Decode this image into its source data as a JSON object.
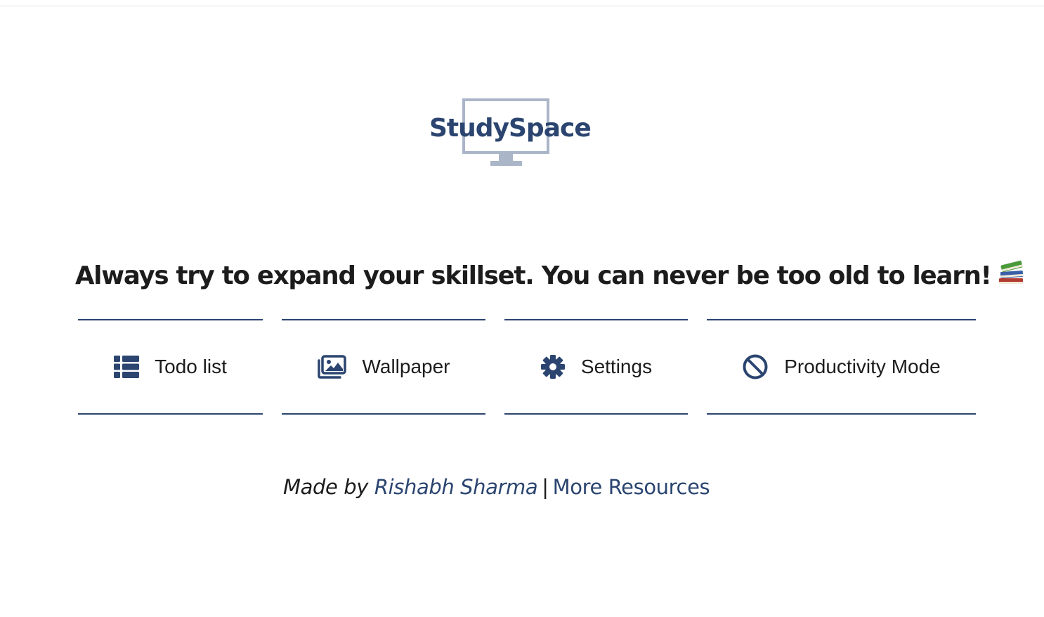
{
  "logo": {
    "text": "StudySpace",
    "icon": "monitor-icon",
    "colors": {
      "text": "#2b4570",
      "monitor": "#aab6c8"
    }
  },
  "quote": {
    "text": "Always try to expand your skillset. You can never be too old to learn!",
    "emoji": "books-icon"
  },
  "menu": {
    "items": [
      {
        "label": "Todo list",
        "icon": "list-icon"
      },
      {
        "label": "Wallpaper",
        "icon": "images-icon"
      },
      {
        "label": "Settings",
        "icon": "gear-icon"
      },
      {
        "label": "Productivity Mode",
        "icon": "ban-icon"
      }
    ]
  },
  "footer": {
    "made_by": "Made by",
    "author": "Rishabh Sharma",
    "separator": "|",
    "resources": "More Resources"
  },
  "colors": {
    "accent": "#2b4570",
    "text": "#1c1c1c",
    "background": "#ffffff"
  }
}
